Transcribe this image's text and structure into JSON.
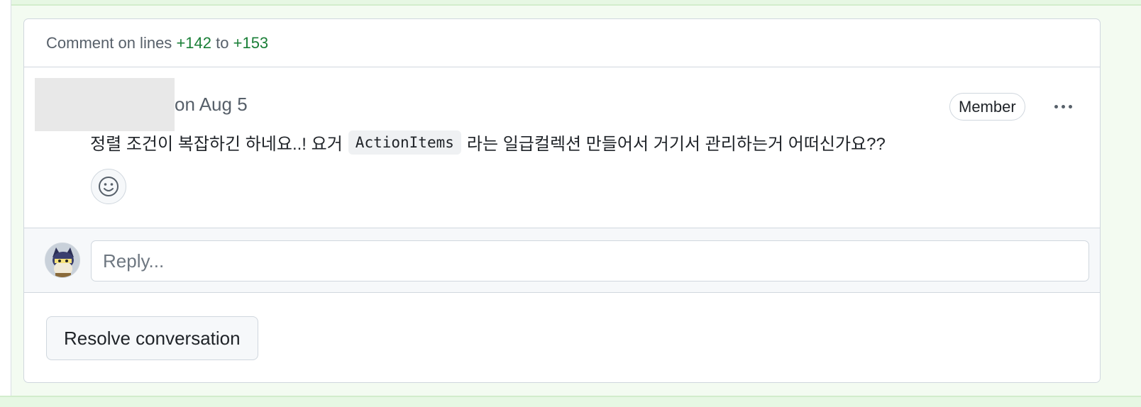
{
  "thread": {
    "header": {
      "prefix": "Comment on lines",
      "line_start": "+142",
      "connector": "to",
      "line_end": "+153"
    },
    "comment": {
      "date": "on Aug 5",
      "badge": "Member",
      "text_before": "정렬 조건이 복잡하긴 하네요..! 요거",
      "code": "ActionItems",
      "text_after": "라는 일급컬렉션 만들어서 거기서 관리하는거 어떠신가요??",
      "more_icon": "kebab-horizontal-icon",
      "reaction_icon": "smiley-icon"
    },
    "reply": {
      "placeholder": "Reply..."
    },
    "resolve_label": "Resolve conversation"
  },
  "colors": {
    "added_line": "#1a7f37",
    "diff_background": "#e6f7e3",
    "border": "#d0d7de"
  }
}
